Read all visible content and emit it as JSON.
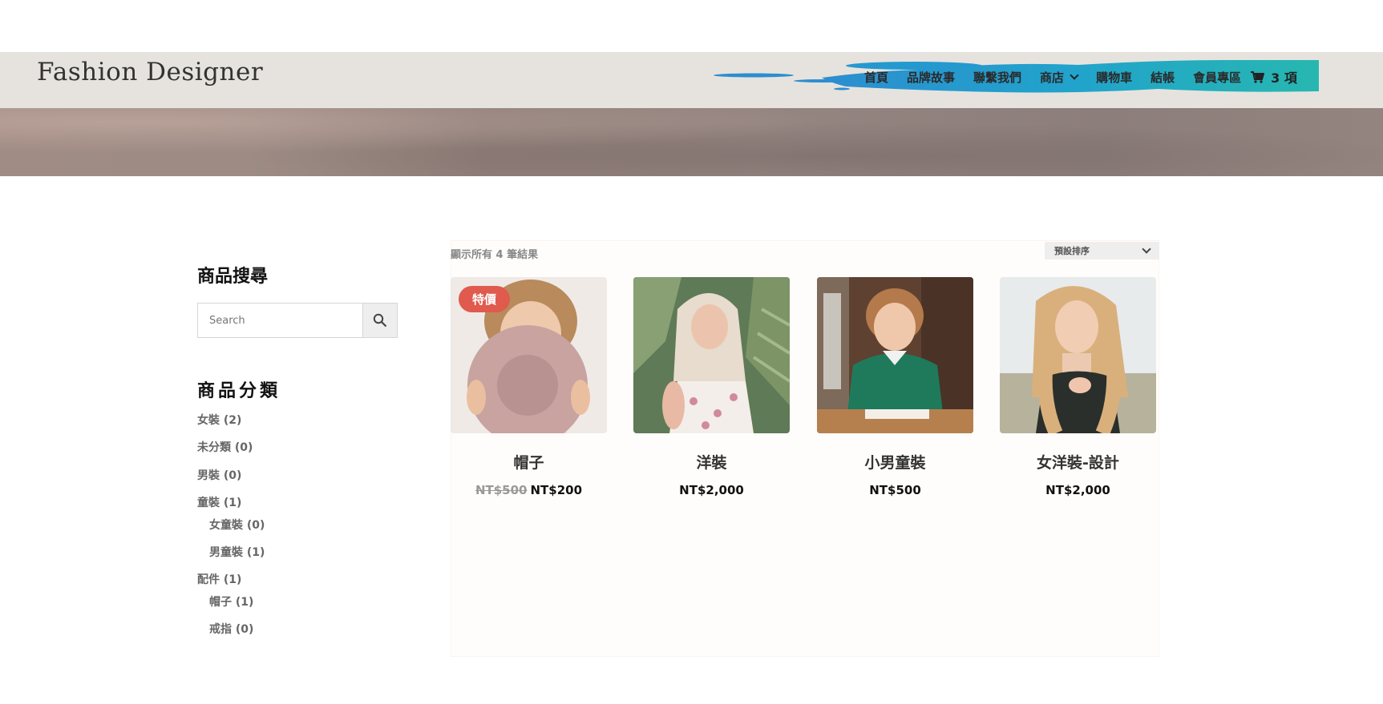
{
  "header": {
    "logo": "Fashion Designer",
    "nav": [
      {
        "label": "首頁"
      },
      {
        "label": "品牌故事"
      },
      {
        "label": "聯繫我們"
      },
      {
        "label": "商店",
        "has_dropdown": true
      },
      {
        "label": "購物車"
      },
      {
        "label": "結帳"
      },
      {
        "label": "會員專區"
      }
    ],
    "cart_label": "3 項",
    "accent": "#1fa8c7"
  },
  "sidebar": {
    "search_title": "商品搜尋",
    "search_placeholder": "Search",
    "categories_title": "商品分類",
    "categories": [
      {
        "label": "女裝 (2)"
      },
      {
        "label": "未分類 (0)"
      },
      {
        "label": "男裝 (0)"
      },
      {
        "label": "童裝 (1)"
      },
      {
        "label": "女童裝 (0)"
      },
      {
        "label": "男童裝 (1)"
      },
      {
        "label": "配件 (1)"
      },
      {
        "label": "帽子 (1)"
      },
      {
        "label": "戒指 (0)"
      }
    ]
  },
  "shop": {
    "result_count": "顯示所有 4 筆結果",
    "sort_selected": "預設排序",
    "products": [
      {
        "name": "帽子",
        "old_price": "NT$500",
        "price": "NT$200",
        "badge": "特價"
      },
      {
        "name": "洋裝",
        "price": "NT$2,000"
      },
      {
        "name": "小男童裝",
        "price": "NT$500"
      },
      {
        "name": "女洋裝-設計",
        "price": "NT$2,000"
      }
    ],
    "sale_color": "#e05a4e"
  }
}
